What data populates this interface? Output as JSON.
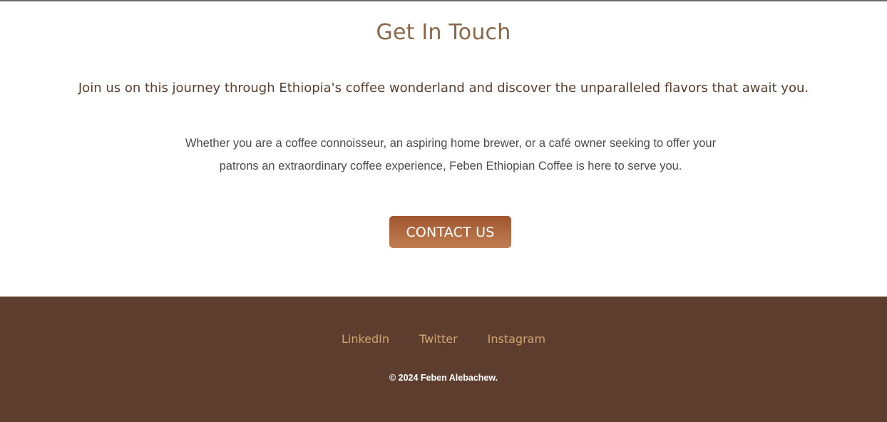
{
  "contact": {
    "title": "Get In Touch",
    "lead": "Join us on this journey through Ethiopia's coffee wonderland and discover the unparalleled flavors that await you.",
    "body_line1": "Whether you are a coffee connoisseur, an aspiring home brewer, or a café owner seeking to offer your",
    "body_line2": "patrons an extraordinary coffee experience, Feben Ethiopian Coffee is here to serve you.",
    "button_label": "CONTACT US"
  },
  "footer": {
    "links": [
      {
        "label": "LinkedIn"
      },
      {
        "label": "Twitter"
      },
      {
        "label": "Instagram"
      }
    ],
    "copyright": "© 2024 Feben Alebachew."
  },
  "colors": {
    "title": "#8a6548",
    "button_top": "#a0562f",
    "button_bottom": "#c07e52",
    "footer_bg": "#5c3d2e",
    "footer_link": "#d3a66f"
  }
}
